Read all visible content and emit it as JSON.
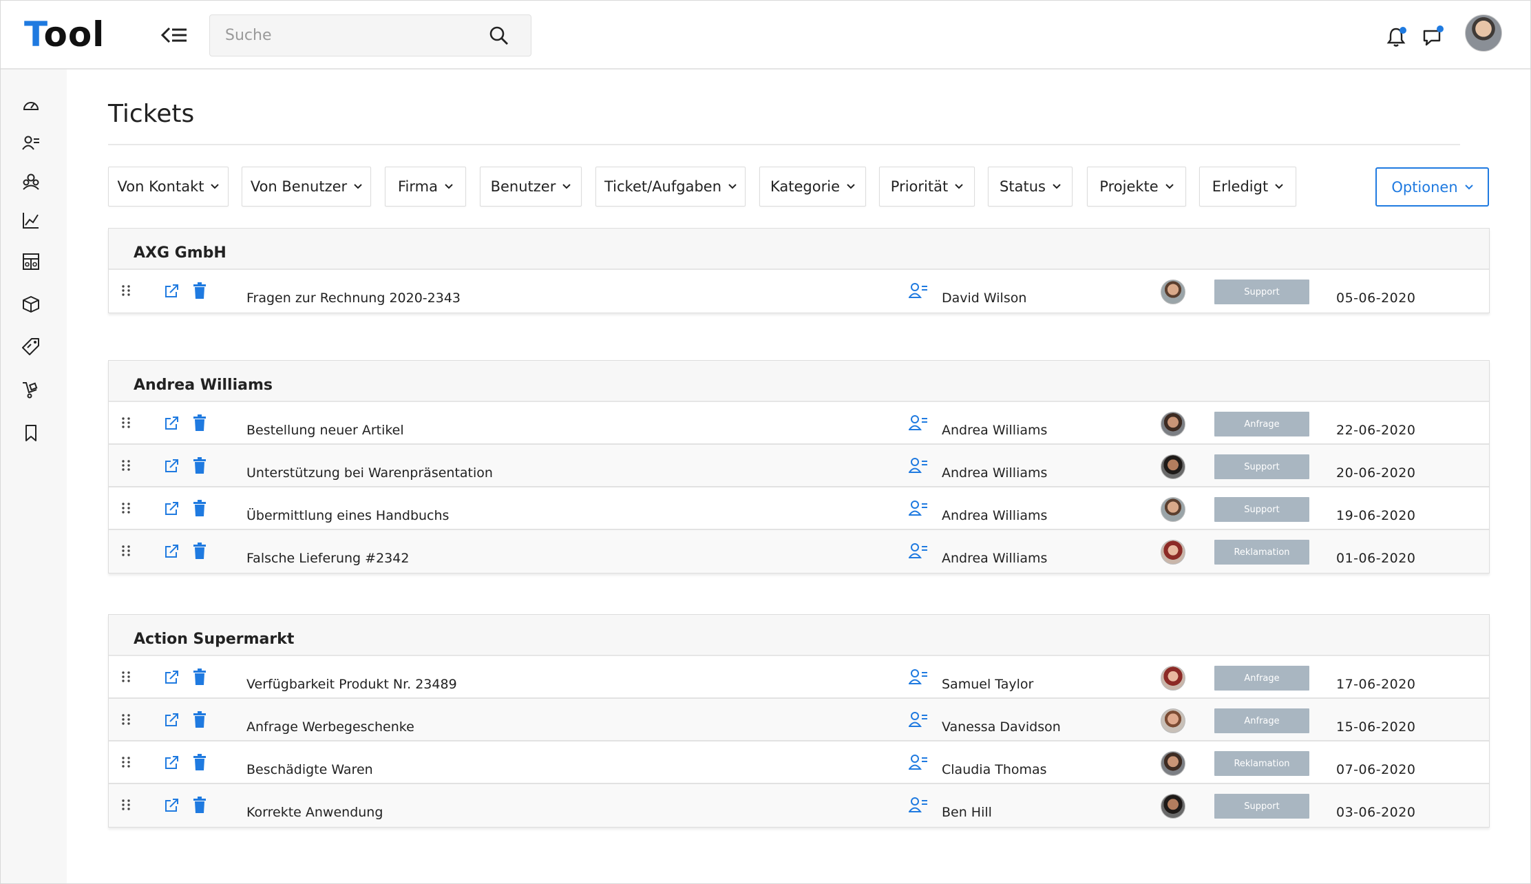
{
  "header": {
    "logo": "Tool",
    "search_placeholder": "Suche"
  },
  "page": {
    "title": "Tickets"
  },
  "filters": [
    "Von Kontakt",
    "Von Benutzer",
    "Firma",
    "Benutzer",
    "Ticket/Aufgaben",
    "Kategorie",
    "Priorität",
    "Status",
    "Projekte",
    "Erledigt"
  ],
  "options_label": "Optionen",
  "sidebar_icons": [
    "dashboard-icon",
    "contacts-icon",
    "groups-icon",
    "chart-icon",
    "table-icon",
    "package-icon",
    "tag-icon",
    "cart-icon",
    "bookmark-icon"
  ],
  "groups": [
    {
      "name": "AXG GmbH",
      "tickets": [
        {
          "subject": "Fragen zur Rechnung 2020-2343",
          "person": "David Wilson",
          "category": "Support",
          "date": "05-06-2020"
        }
      ]
    },
    {
      "name": "Andrea Williams",
      "tickets": [
        {
          "subject": "Bestellung neuer Artikel",
          "person": "Andrea Williams",
          "category": "Anfrage",
          "date": "22-06-2020"
        },
        {
          "subject": "Unterstützung bei Warenpräsentation",
          "person": "Andrea Williams",
          "category": "Support",
          "date": "20-06-2020"
        },
        {
          "subject": "Übermittlung eines Handbuchs",
          "person": "Andrea Williams",
          "category": "Support",
          "date": "19-06-2020"
        },
        {
          "subject": "Falsche Lieferung #2342",
          "person": "Andrea Williams",
          "category": "Reklamation",
          "date": "01-06-2020"
        }
      ]
    },
    {
      "name": "Action Supermarkt",
      "tickets": [
        {
          "subject": "Verfügbarkeit Produkt Nr. 23489",
          "person": "Samuel Taylor",
          "category": "Anfrage",
          "date": "17-06-2020"
        },
        {
          "subject": "Anfrage Werbegeschenke",
          "person": "Vanessa Davidson",
          "category": "Anfrage",
          "date": "15-06-2020"
        },
        {
          "subject": "Beschädigte Waren",
          "person": "Claudia Thomas",
          "category": "Reklamation",
          "date": "07-06-2020"
        },
        {
          "subject": "Korrekte Anwendung",
          "person": "Ben Hill",
          "category": "Support",
          "date": "03-06-2020"
        }
      ]
    }
  ],
  "colors": {
    "accent": "#1f7ae0",
    "tag": "#a9b6c1",
    "sidebar_bg": "#f7f7f7"
  }
}
